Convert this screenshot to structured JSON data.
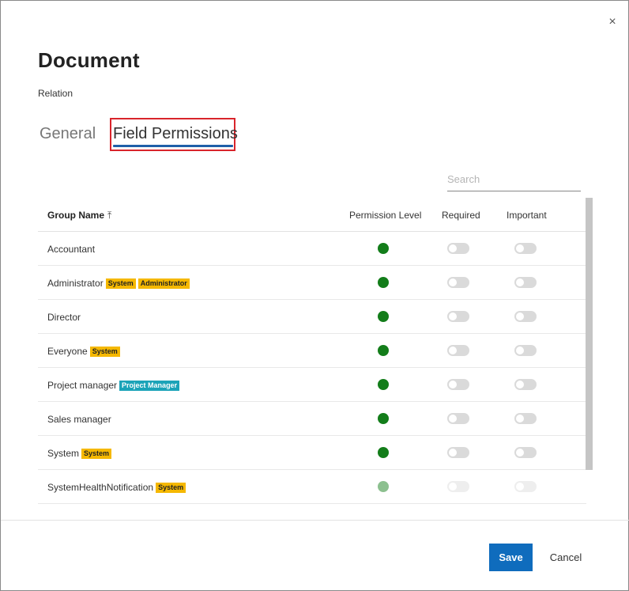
{
  "dialog": {
    "close_glyph": "×",
    "title": "Document",
    "subtitle": "Relation"
  },
  "tabs": [
    {
      "label": "General",
      "active": false
    },
    {
      "label": "Field Permissions",
      "active": true
    }
  ],
  "search": {
    "placeholder": "Search",
    "value": ""
  },
  "table": {
    "headers": {
      "group_name": "Group Name",
      "permission_level": "Permission Level",
      "required": "Required",
      "important": "Important"
    },
    "sort_glyph": "⤒",
    "rows": [
      {
        "name": "Accountant",
        "badges": [],
        "permission": "granted",
        "required": false,
        "important": false
      },
      {
        "name": "Administrator",
        "badges": [
          {
            "text": "System",
            "style": "yellow"
          },
          {
            "text": "Administrator",
            "style": "yellow"
          }
        ],
        "permission": "granted",
        "required": false,
        "important": false
      },
      {
        "name": "Director",
        "badges": [],
        "permission": "granted",
        "required": false,
        "important": false
      },
      {
        "name": "Everyone",
        "badges": [
          {
            "text": "System",
            "style": "yellow"
          }
        ],
        "permission": "granted",
        "required": false,
        "important": false
      },
      {
        "name": "Project manager",
        "badges": [
          {
            "text": "Project Manager",
            "style": "teal"
          }
        ],
        "permission": "granted",
        "required": false,
        "important": false
      },
      {
        "name": "Sales manager",
        "badges": [],
        "permission": "granted",
        "required": false,
        "important": false
      },
      {
        "name": "System",
        "badges": [
          {
            "text": "System",
            "style": "yellow"
          }
        ],
        "permission": "granted",
        "required": false,
        "important": false
      },
      {
        "name": "SystemHealthNotification",
        "badges": [
          {
            "text": "System",
            "style": "yellow"
          }
        ],
        "permission": "granted",
        "required": false,
        "important": false
      }
    ]
  },
  "footer": {
    "save_label": "Save",
    "cancel_label": "Cancel"
  },
  "colors": {
    "accent_blue": "#0f6cbd",
    "tab_underline": "#1f5fa8",
    "highlight_red": "#d9242b",
    "permission_green": "#137d1a",
    "badge_yellow": "#f5b800",
    "badge_teal": "#1ba3b8"
  }
}
